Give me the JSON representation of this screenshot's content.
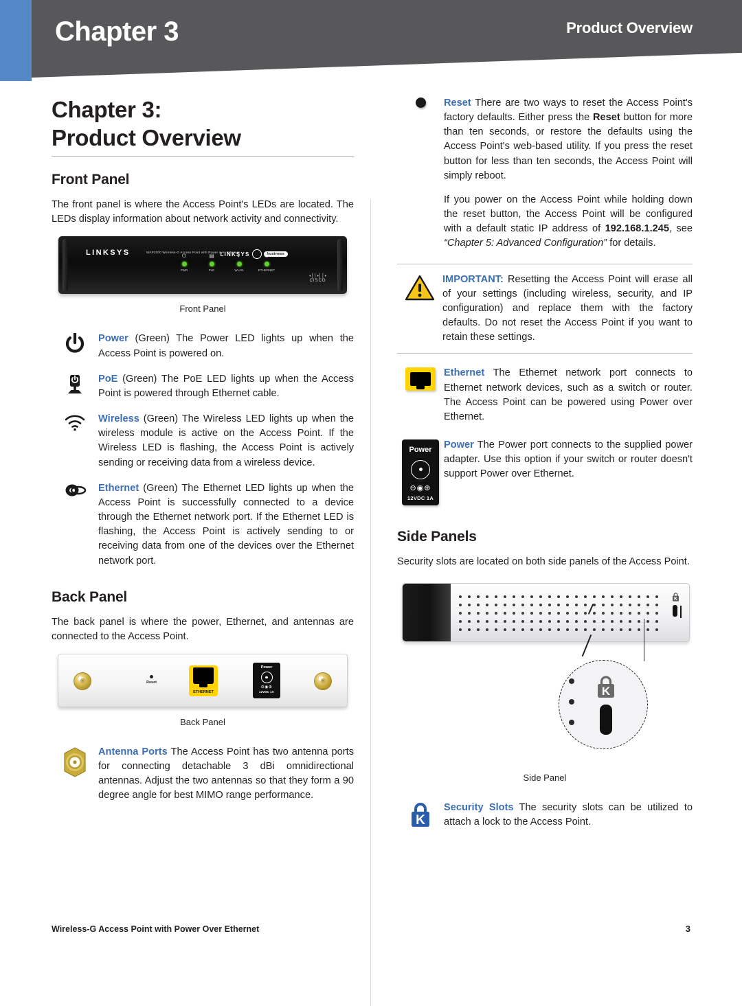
{
  "header": {
    "chapter_label": "Chapter 3",
    "section_label": "Product Overview"
  },
  "doc": {
    "title_line1": "Chapter 3:",
    "title_line2": "Product Overview"
  },
  "front_panel": {
    "heading": "Front Panel",
    "intro": "The front panel is where the Access Point's LEDs are located. The LEDs display information about network activity and connectivity.",
    "figure_caption": "Front Panel",
    "device": {
      "brand": "LINKSYS",
      "brand_mark": "®",
      "model_line": "WAP2000 Wireless-G Access Point with Power over Ethernet",
      "brand_secondary": "LINKSYS",
      "pill_label": "business",
      "cisco_bars": "•││•││•",
      "cisco_label": "CISCO",
      "leds": [
        {
          "glyph": "⏻",
          "label": "PWR"
        },
        {
          "glyph": "⬜",
          "label": "PoE"
        },
        {
          "glyph": "◔",
          "label": "WLAN"
        },
        {
          "glyph": "⬭",
          "label": "ETHERNET"
        }
      ]
    },
    "items": [
      {
        "icon": "power-icon",
        "term": "Power",
        "text": "  (Green) The Power LED lights up when the Access Point is powered on."
      },
      {
        "icon": "poe-device-icon",
        "term": "PoE",
        "text": "  (Green) The PoE LED lights up when the Access Point is powered through Ethernet cable."
      },
      {
        "icon": "wireless-icon",
        "term": "Wireless",
        "text": "  (Green) The Wireless LED lights up when the wireless module is active on the Access Point. If the Wireless LED is flashing, the Access Point is actively sending or receiving data from a wireless device."
      },
      {
        "icon": "ethernet-led-icon",
        "term": "Ethernet",
        "text": "   (Green) The Ethernet LED lights up when the Access Point is successfully connected to a device through the Ethernet network port. If the Ethernet LED is flashing, the Access Point is actively sending to or receiving data from one of the devices over the Ethernet network port."
      }
    ]
  },
  "back_panel": {
    "heading": "Back Panel",
    "intro": "The back panel is where the power, Ethernet, and antennas are connected to the Access Point.",
    "figure_caption": "Back Panel",
    "device": {
      "reset_label": "Reset",
      "ethernet_label": "ETHERNET",
      "power_label": "Power",
      "power_polarity": "⊖◉⊕",
      "power_rating": "12VDC 1A"
    },
    "antenna_item": {
      "term": "Antenna Ports",
      "text": " The Access Point has two antenna ports for connecting detachable 3 dBi omnidirectional antennas. Adjust the two antennas so that they form a 90 degree angle for best MIMO range performance."
    }
  },
  "reset_section": {
    "term": "Reset",
    "paragraph1_a": "  There are two ways to reset the Access Point's factory defaults. Either press the ",
    "paragraph1_bold": "Reset",
    "paragraph1_b": " button for more than ten seconds, or restore the defaults using the Access Point's web-based utility. If you press the reset button for less than ten seconds, the Access Point will simply reboot.",
    "paragraph2_a": "If you power on the Access Point while holding down the reset button, the Access Point will be configured with a default static IP address of ",
    "paragraph2_ip": "192.168.1.245",
    "paragraph2_b": ", see ",
    "paragraph2_italic": "“Chapter 5: Advanced Configuration”",
    "paragraph2_c": " for details."
  },
  "important_note": {
    "label": "IMPORTANT:",
    "text": " Resetting the Access Point will erase all of your settings (including wireless, security, and IP configuration) and replace them with the factory defaults. Do not reset the Access Point if you want to retain these settings."
  },
  "port_items": [
    {
      "icon": "ethernet-port-icon",
      "term": "Ethernet",
      "text": "   The Ethernet network port connects to Ethernet network devices, such as a switch or router. The Access Point can be powered using Power over Ethernet."
    },
    {
      "icon": "power-port-icon",
      "term": "Power",
      "text": "   The Power port connects to the supplied power adapter. Use this option if your switch or router doesn't support Power over Ethernet.",
      "jack_label": "Power",
      "jack_polarity": "⊖◉⊕",
      "jack_rating": "12VDC 1A"
    }
  ],
  "side_panels": {
    "heading": "Side Panels",
    "intro": "Security slots are located on both side panels of the Access Point.",
    "figure_caption": "Side Panel",
    "security_item": {
      "icon": "kensington-lock-icon",
      "term": "Security Slots",
      "text": "  The security slots can be utilized to attach a lock to the Access Point."
    }
  },
  "footer": {
    "title": "Wireless-G Access Point with  Power Over Ethernet",
    "page_number": "3"
  },
  "colors": {
    "banner_gray": "#58585a",
    "banner_blue": "#5488c7",
    "accent_blue": "#3d6fb4",
    "body_text": "#231f20",
    "led_green": "#5fd32e",
    "ethernet_yellow": "#ffd400"
  }
}
